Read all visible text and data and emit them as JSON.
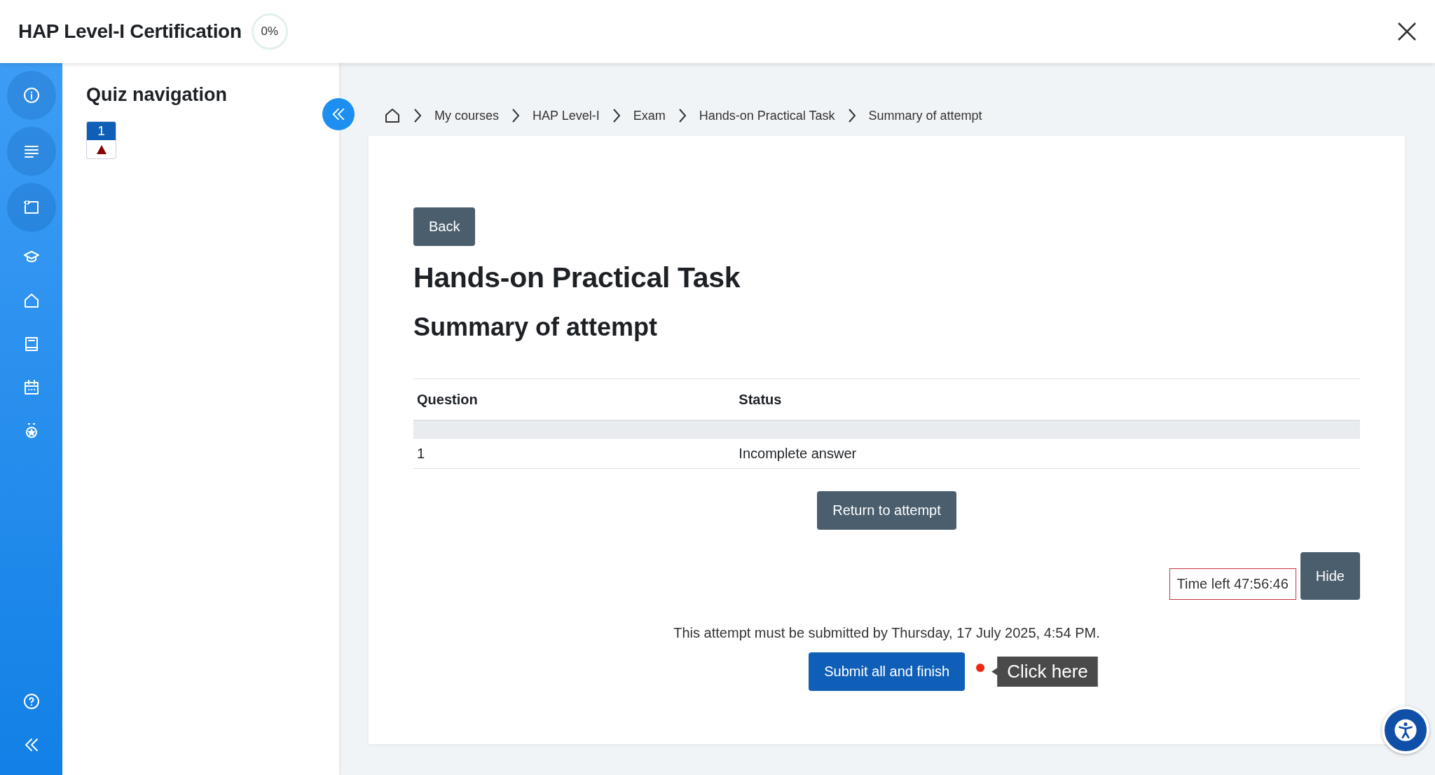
{
  "header": {
    "title": "HAP Level-I Certification",
    "progress": "0%"
  },
  "quiz_nav": {
    "title": "Quiz navigation",
    "questions": [
      {
        "number": "1",
        "answered": false
      }
    ]
  },
  "breadcrumbs": [
    "My courses",
    "HAP Level-I",
    "Exam",
    "Hands-on Practical Task",
    "Summary of attempt"
  ],
  "summary": {
    "back_button": "Back",
    "title": "Hands-on Practical Task",
    "subtitle": "Summary of attempt",
    "table": {
      "columns": [
        "Question",
        "Status"
      ],
      "rows": [
        [
          "1",
          "Incomplete answer"
        ]
      ]
    },
    "return_button": "Return to attempt",
    "timer": "Time left 47:56:46",
    "hide_button": "Hide",
    "deadline": "This attempt must be submitted by Thursday, 17 July 2025, 4:54 PM.",
    "submit_button": "Submit all and finish",
    "tooltip": "Click here"
  }
}
